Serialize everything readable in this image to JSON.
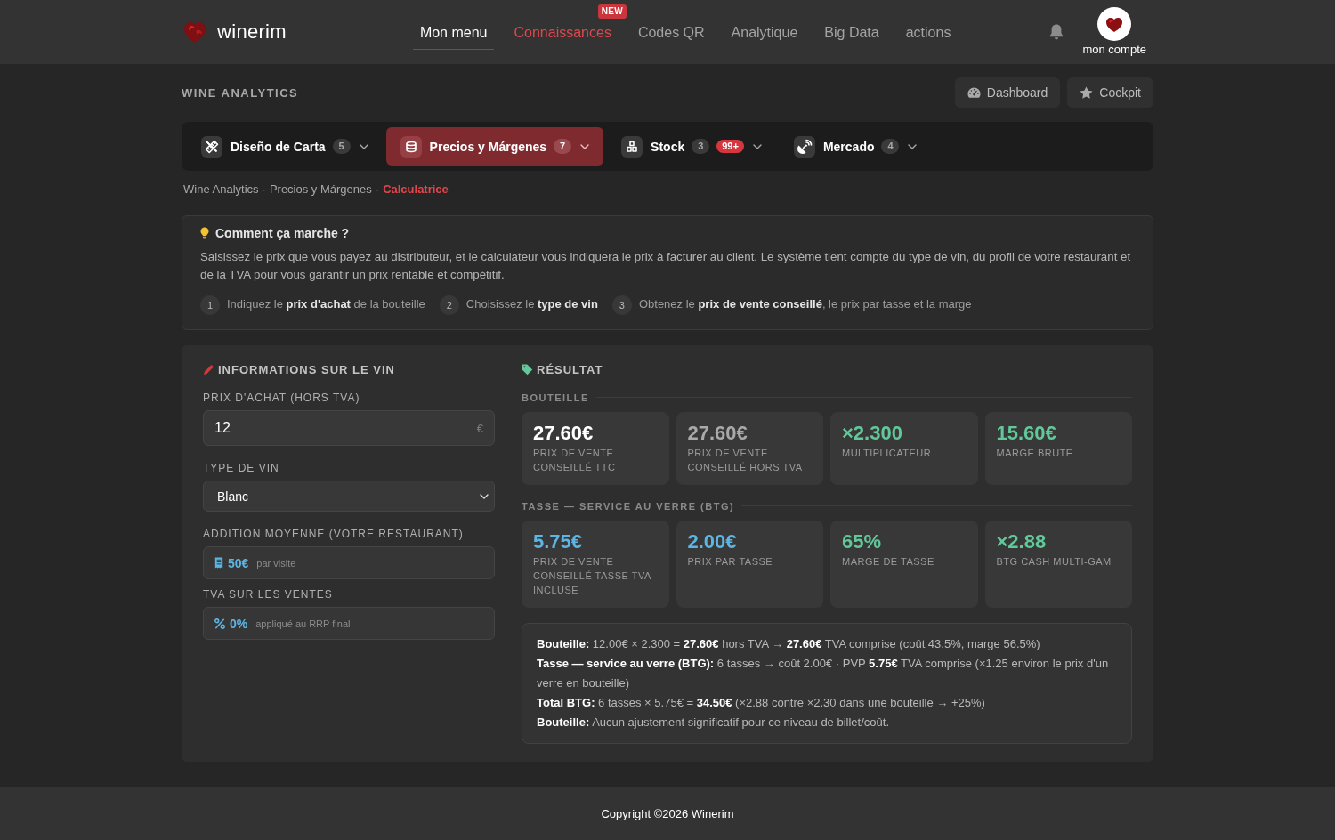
{
  "header": {
    "logo_text": "winerim",
    "nav": [
      {
        "label": "Mon menu",
        "selected": true,
        "highlight": false
      },
      {
        "label": "Connaissances",
        "selected": false,
        "highlight": true,
        "badge": "NEW"
      },
      {
        "label": "Codes QR",
        "selected": false,
        "highlight": false
      },
      {
        "label": "Analytique",
        "selected": false,
        "highlight": false
      },
      {
        "label": "Big Data",
        "selected": false,
        "highlight": false
      },
      {
        "label": "actions",
        "selected": false,
        "highlight": false
      }
    ],
    "account_label": "mon compte"
  },
  "page_title": "WINE ANALYTICS",
  "page_buttons": [
    {
      "label": "Dashboard"
    },
    {
      "label": "Cockpit"
    }
  ],
  "category_tabs": [
    {
      "label": "Diseño de Carta",
      "count": "5",
      "selected": false
    },
    {
      "label": "Precios y Márgenes",
      "count": "7",
      "selected": true
    },
    {
      "label": "Stock",
      "count": "3",
      "alert": "99+",
      "selected": false
    },
    {
      "label": "Mercado",
      "count": "4",
      "selected": false
    }
  ],
  "breadcrumb": {
    "separator": "·",
    "items": [
      {
        "label": "Wine Analytics",
        "current": false
      },
      {
        "label": "Precios y Márgenes",
        "current": false
      },
      {
        "label": "Calculatrice",
        "current": true
      }
    ]
  },
  "how_it_works": {
    "title": "Comment ça marche ?",
    "text": "Saisissez le prix que vous payez au distributeur, et le calculateur vous indiquera le prix à facturer au client. Le système tient compte du type de vin, du profil de votre restaurant et de la TVA pour vous garantir un prix rentable et compétitif.",
    "steps": [
      {
        "number": "1",
        "text": "Indiquez le **prix d'achat** de la bouteille"
      },
      {
        "number": "2",
        "text": "Choisissez le **type de vin**"
      },
      {
        "number": "3",
        "text": "Obtenez le **prix de vente conseillé**, le prix par tasse et la marge"
      }
    ]
  },
  "form": {
    "title": "INFORMATIONS SUR LE VIN",
    "fields": [
      {
        "kind": "input",
        "label": "PRIX D'ACHAT (HORS TVA)",
        "value": "12",
        "suffix": "€"
      },
      {
        "kind": "select",
        "label": "TYPE DE VIN",
        "value": "Blanc"
      },
      {
        "kind": "info",
        "label": "ADDITION MOYENNE (VOTRE RESTAURANT)",
        "value": "50€",
        "note": "par visite"
      },
      {
        "kind": "info",
        "label": "TVA SUR LES VENTES",
        "value": "0%",
        "note": "appliqué au RRP final"
      }
    ]
  },
  "result": {
    "title": "RÉSULTAT",
    "sections": [
      {
        "title": "BOUTEILLE",
        "cards": [
          {
            "value": "27.60€",
            "label": "PRIX DE VENTE CONSEILLÉ TTC",
            "color": "#ffffff"
          },
          {
            "value": "27.60€",
            "label": "PRIX DE VENTE CONSEILLÉ HORS TVA",
            "color": "#a9a9a9"
          },
          {
            "value": "×2.300",
            "label": "MULTIPLICATEUR",
            "color": "#62c89a"
          },
          {
            "value": "15.60€",
            "label": "MARGE BRUTE",
            "color": "#62c89a"
          }
        ]
      },
      {
        "title": "TASSE — SERVICE AU VERRE (BTG)",
        "cards": [
          {
            "value": "5.75€",
            "label": "PRIX DE VENTE CONSEILLÉ TASSE TVA INCLUSE",
            "color": "#5db5e4"
          },
          {
            "value": "2.00€",
            "label": "PRIX PAR TASSE",
            "color": "#5db5e4"
          },
          {
            "value": "65%",
            "label": "MARGE DE TASSE",
            "color": "#62c89a"
          },
          {
            "value": "×2.88",
            "label": "BTG CASH MULTI-GAM",
            "color": "#62c89a"
          }
        ]
      }
    ],
    "summary": [
      "**Bouteille:** 12.00€ × 2.300 = **27.60€** hors TVA → **27.60€** TVA comprise (coût 43.5%, marge 56.5%)",
      "**Tasse — service au verre (BTG):** 6 tasses → coût 2.00€ · PVP **5.75€** TVA comprise (×1.25 environ le prix d'un verre en bouteille)",
      "**Total BTG:** 6 tasses × 5.75€ = **34.50€** (×2.88 contre ×2.30 dans une bouteille → +25%)",
      "**Bouteille:** Aucun ajustement significatif pour ce niveau de billet/coût."
    ]
  },
  "footer": "Copyright ©2026 Winerim"
}
